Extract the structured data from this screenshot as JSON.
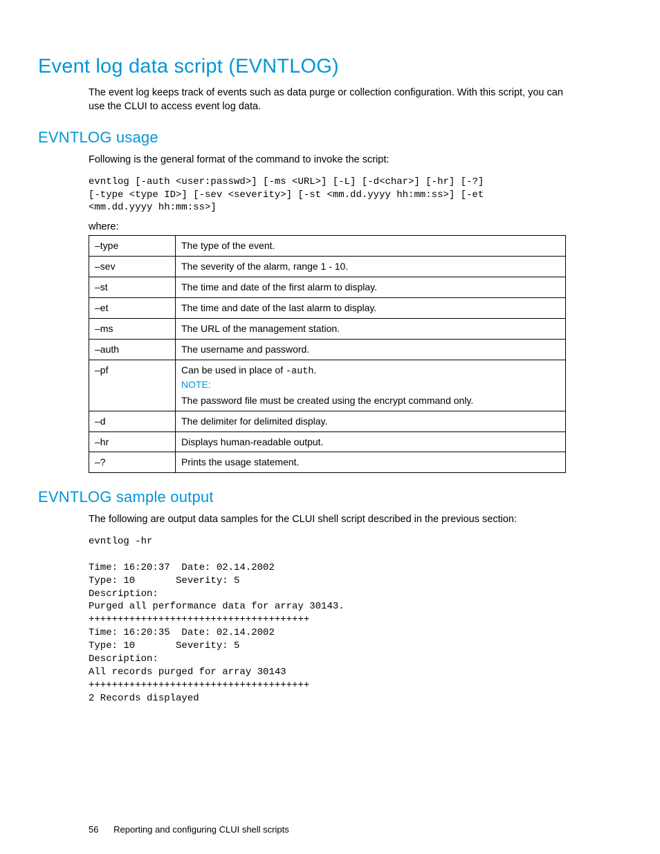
{
  "h1": "Event log data script (EVNTLOG)",
  "intro": "The event log keeps track of events such as data purge or collection configuration. With this script, you can use the CLUI to access event log data.",
  "usage_heading": "EVNTLOG usage",
  "usage_intro": "Following is the general format of the command to invoke the script:",
  "usage_code": "evntlog [-auth <user:passwd>] [-ms <URL>] [-L] [-d<char>] [-hr] [-?]\n[-type <type ID>] [-sev <severity>] [-st <mm.dd.yyyy hh:mm:ss>] [-et\n<mm.dd.yyyy hh:mm:ss>]",
  "where_label": "where:",
  "options": [
    {
      "flag": "–type",
      "desc": "The type of the event."
    },
    {
      "flag": "–sev",
      "desc": "The severity of the alarm, range 1 - 10."
    },
    {
      "flag": "–st",
      "desc": "The time and date of the first alarm to display."
    },
    {
      "flag": "–et",
      "desc": "The time and date of the last alarm to display."
    },
    {
      "flag": "–ms",
      "desc": "The URL of the management station."
    },
    {
      "flag": "–auth",
      "desc": "The username and password."
    },
    {
      "flag": "–pf",
      "desc_pre": "Can be used in place of ",
      "desc_code": "-auth",
      "desc_post": ".",
      "note_label": "NOTE:",
      "note_text": "The password file must be created using the encrypt command only."
    },
    {
      "flag": "–d",
      "desc": "The delimiter for delimited display."
    },
    {
      "flag": "–hr",
      "desc": "Displays human-readable output."
    },
    {
      "flag": "–?",
      "desc": "Prints the usage statement."
    }
  ],
  "sample_heading": "EVNTLOG sample output",
  "sample_intro": "The following are output data samples for the CLUI shell script described in the previous section:",
  "sample_code": "evntlog -hr\n\nTime: 16:20:37  Date: 02.14.2002\nType: 10       Severity: 5\nDescription:\nPurged all performance data for array 30143.\n++++++++++++++++++++++++++++++++++++++\nTime: 16:20:35  Date: 02.14.2002\nType: 10       Severity: 5\nDescription:\nAll records purged for array 30143\n++++++++++++++++++++++++++++++++++++++\n2 Records displayed",
  "footer": {
    "page_number": "56",
    "section": "Reporting and configuring CLUI shell scripts"
  }
}
